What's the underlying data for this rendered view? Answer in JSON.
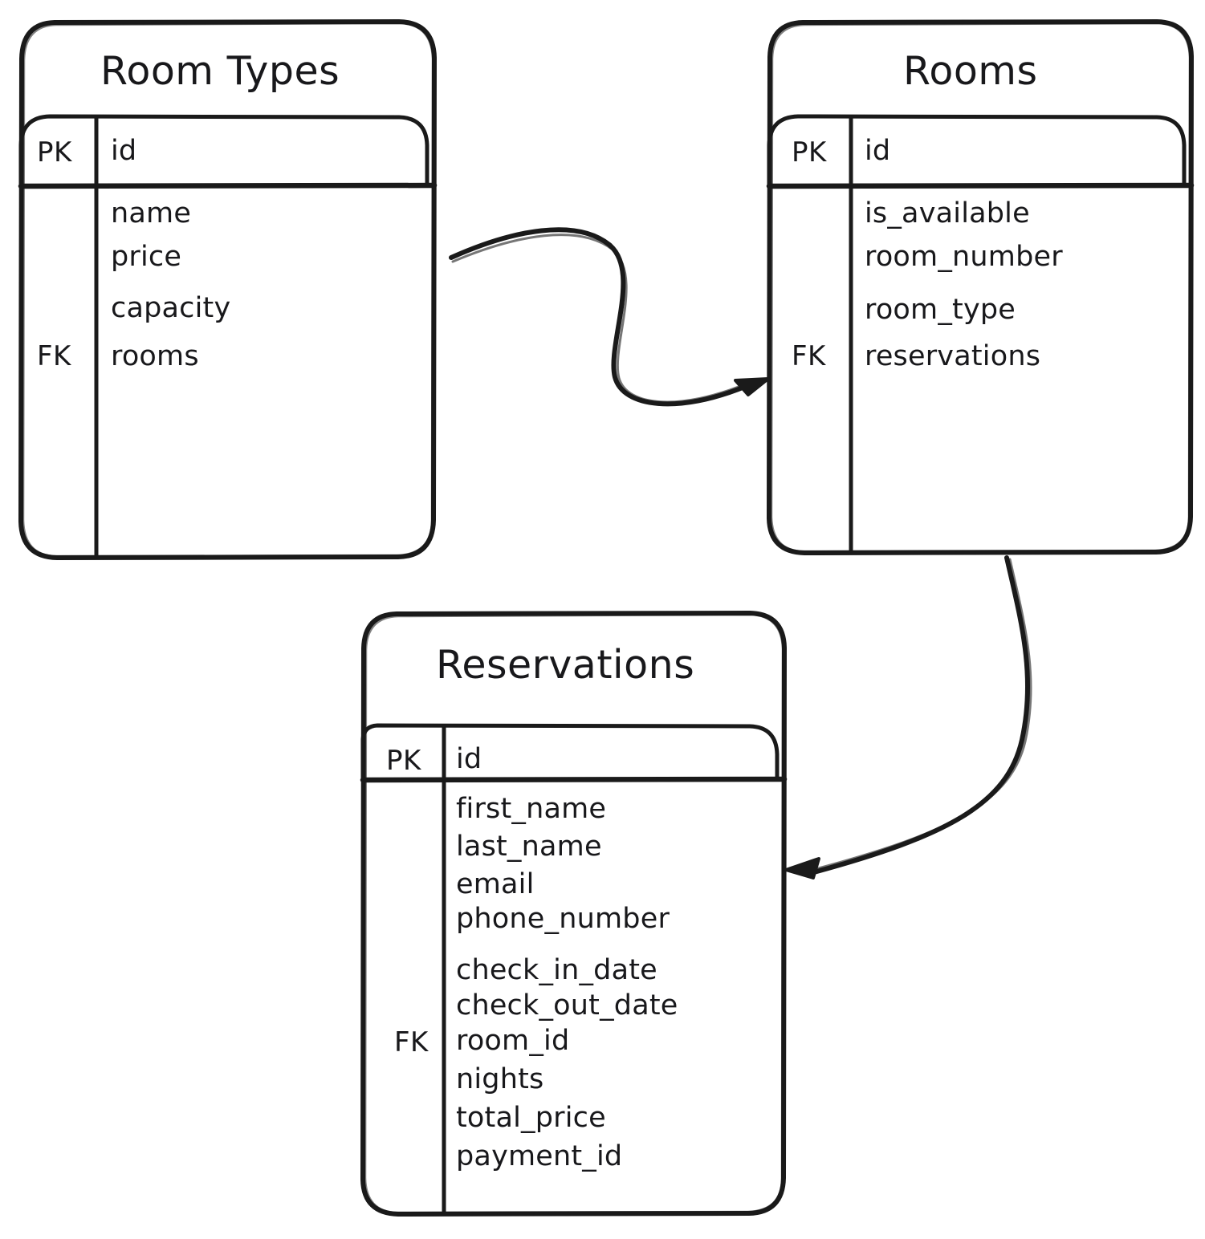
{
  "diagram": {
    "type": "entity-relationship-diagram",
    "style": "hand-drawn",
    "background_color": "#ffffff",
    "stroke_color": "#1a1a1a",
    "entities": [
      {
        "id": "room_types",
        "title": "Room Types",
        "primary_key": {
          "key": "PK",
          "field": "id"
        },
        "attribute_groups": [
          {
            "fields": [
              "name",
              "price"
            ]
          },
          {
            "fields": [
              "capacity"
            ]
          },
          {
            "fields": [
              "rooms"
            ]
          }
        ],
        "foreign_key": {
          "key": "FK",
          "field": "rooms"
        }
      },
      {
        "id": "rooms",
        "title": "Rooms",
        "primary_key": {
          "key": "PK",
          "field": "id"
        },
        "attribute_groups": [
          {
            "fields": [
              "is_available",
              "room_number"
            ]
          },
          {
            "fields": [
              "room_type"
            ]
          },
          {
            "fields": [
              "reservations"
            ]
          }
        ],
        "foreign_key": {
          "key": "FK",
          "field": "reservations"
        }
      },
      {
        "id": "reservations",
        "title": "Reservations",
        "primary_key": {
          "key": "PK",
          "field": "id"
        },
        "attribute_groups": [
          {
            "fields": [
              "first_name",
              "last_name",
              "email",
              "phone_number"
            ]
          },
          {
            "fields": [
              "check_in_date",
              "check_out_date",
              "room_id",
              "nights",
              "total_price",
              "payment_id"
            ]
          }
        ],
        "foreign_key": {
          "key": "FK",
          "field": "room_id"
        }
      }
    ],
    "relationships": [
      {
        "from": "room_types",
        "to": "rooms",
        "arrow": "single-ended"
      },
      {
        "from": "rooms",
        "to": "reservations",
        "arrow": "single-ended"
      }
    ]
  }
}
